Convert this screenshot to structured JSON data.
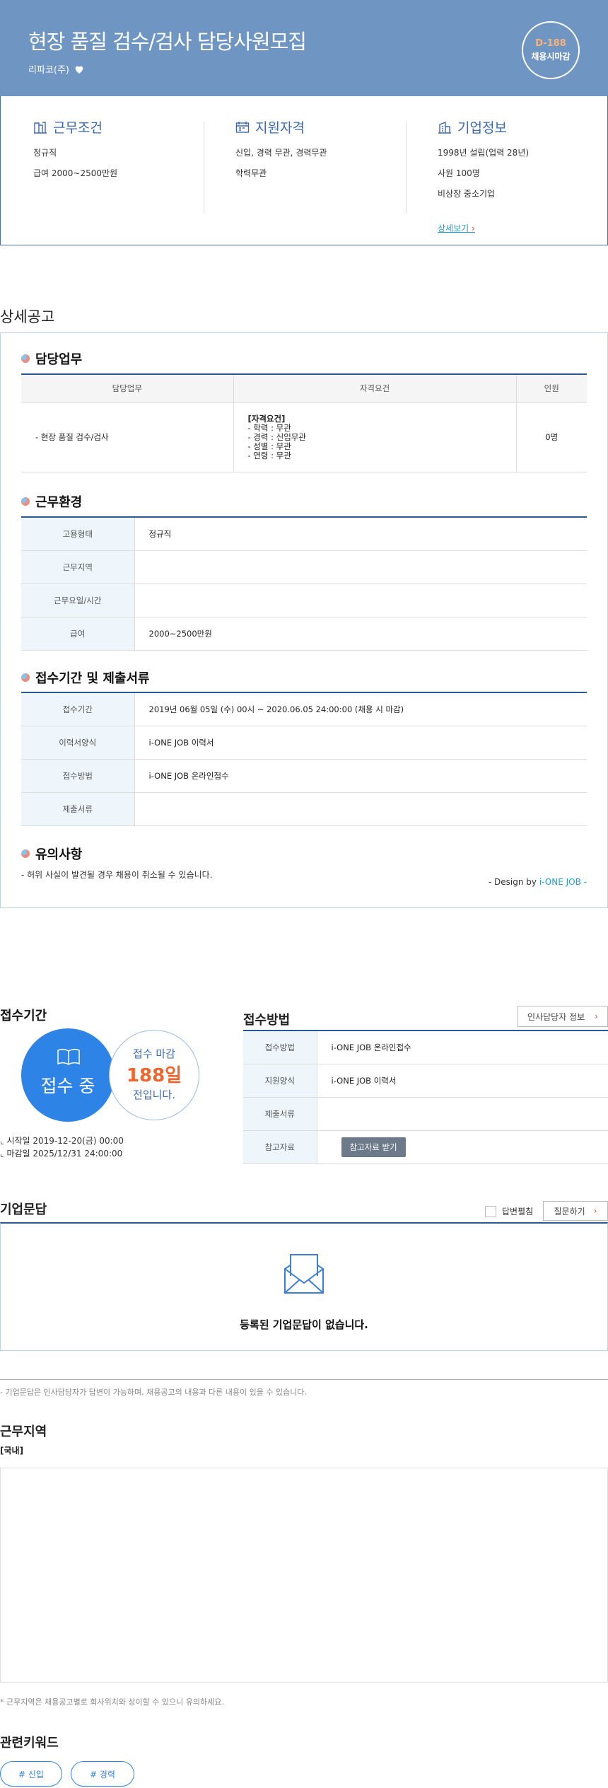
{
  "header": {
    "title": "현장 품질 검수/검사 담당사원모집",
    "company": "리파코(주)",
    "dday": "D-188",
    "dday_label": "채용시마감"
  },
  "summary": {
    "work": {
      "title": "근무조건",
      "lines": [
        "정규직",
        "급여 2000~2500만원"
      ]
    },
    "qual": {
      "title": "지원자격",
      "lines": [
        "신입, 경력 무관, 경력무관",
        "학력무관"
      ]
    },
    "company": {
      "title": "기업정보",
      "lines": [
        "1998년 설립(업력 28년)",
        "사원 100명",
        "비상장 중소기업"
      ],
      "link": "상세보기"
    }
  },
  "detail": {
    "section_title": "상세공고",
    "duty": {
      "title": "담당업무",
      "headers": [
        "담당업무",
        "자격요건",
        "인원"
      ],
      "task": "- 현장 품질 검수/검사",
      "req": [
        "[자격요건]",
        "- 학력 : 무관",
        "- 경력 : 신입무관",
        "- 성별 : 무관",
        "- 연령 : 무관"
      ],
      "count": "0명"
    },
    "env": {
      "title": "근무환경",
      "rows": [
        {
          "k": "고용형태",
          "v": "정규직"
        },
        {
          "k": "근무지역",
          "v": ""
        },
        {
          "k": "근무요일/시간",
          "v": ""
        },
        {
          "k": "급여",
          "v": "2000~2500만원"
        }
      ]
    },
    "apply": {
      "title": "접수기간 및 제출서류",
      "rows": [
        {
          "k": "접수기간",
          "v": "2019년 06월 05일 (수) 00시 ~ 2020.06.05 24:00:00 (채용 시 마감)"
        },
        {
          "k": "이력서양식",
          "v": "i-ONE JOB 이력서"
        },
        {
          "k": "접수방법",
          "v": "i-ONE JOB 온라인접수"
        },
        {
          "k": "제출서류",
          "v": ""
        }
      ]
    },
    "notice": {
      "title": "유의사항",
      "text": "- 허위 사실이 발견될 경우 채용이 취소될 수 있습니다."
    },
    "design": {
      "prefix": "- Design by ",
      "brand": "i-ONE JOB -"
    }
  },
  "period": {
    "title": "접수기간",
    "status": "접수 중",
    "deadline_a": "접수 마감",
    "deadline_days": "188일",
    "deadline_c": "전입니다.",
    "start": "시작일 2019-12-20(금) 00:00",
    "end": "마감일 2025/12/31 24:00:00"
  },
  "method": {
    "title": "접수방법",
    "hr_button": "인사담당자 정보",
    "rows": [
      {
        "k": "접수방법",
        "v": "i-ONE JOB 온라인접수"
      },
      {
        "k": "지원양식",
        "v": "i-ONE JOB 이력서"
      },
      {
        "k": "제출서류",
        "v": ""
      },
      {
        "k": "참고자료",
        "v": ""
      }
    ],
    "ref_button": "참고자료 받기"
  },
  "qa": {
    "title": "기업문답",
    "checkbox_label": "답변펼침",
    "ask_button": "질문하기",
    "empty": "등록된 기업문답이 없습니다.",
    "note": "- 기업문답은 인사담당자가 답변이 가능하며, 채용공고의 내용과 다른 내용이 있을 수 있습니다."
  },
  "location": {
    "title": "근무지역",
    "sub": "[국내]",
    "note": "* 근무지역은 채용공고별로 회사위치와 상이할 수 있으니 유의하세요."
  },
  "keywords": {
    "title": "관련키워드",
    "items": [
      "# 신입",
      "# 경력"
    ]
  },
  "colors": {
    "hero": "#6f95c3",
    "accent": "#2e83e6",
    "navy": "#2b5797",
    "orange": "#f0652e"
  }
}
